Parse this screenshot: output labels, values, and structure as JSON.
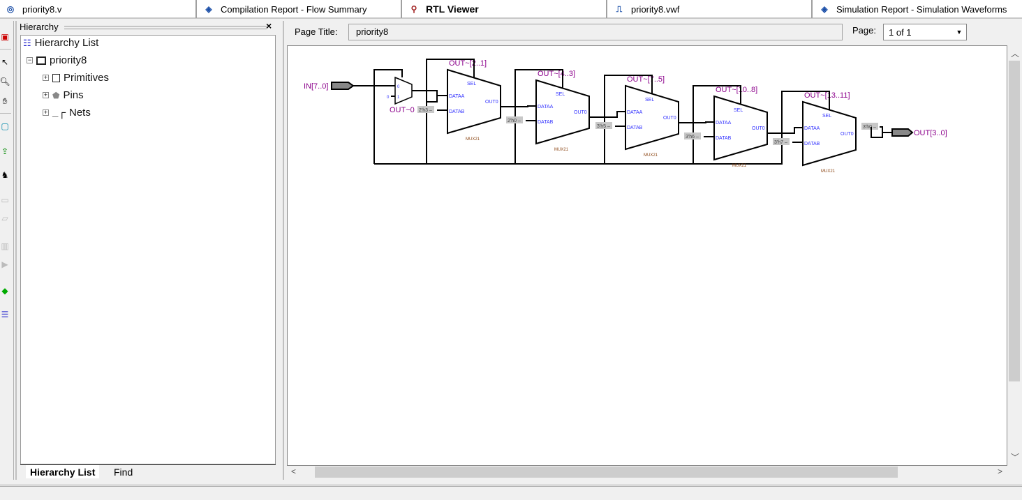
{
  "tabs": [
    {
      "label": "priority8.v",
      "icon": "verilog-file-icon"
    },
    {
      "label": "Compilation Report - Flow Summary",
      "icon": "report-icon"
    },
    {
      "label": "RTL Viewer",
      "icon": "rtl-viewer-icon",
      "active": true
    },
    {
      "label": "priority8.vwf",
      "icon": "waveform-file-icon"
    },
    {
      "label": "Simulation Report - Simulation Waveforms",
      "icon": "report-icon"
    }
  ],
  "hierarchy": {
    "title": "Hierarchy",
    "root_label": "Hierarchy List",
    "top": "priority8",
    "children": [
      {
        "label": "Primitives"
      },
      {
        "label": "Pins"
      },
      {
        "label": "Nets"
      }
    ],
    "bottom_tabs": [
      "Hierarchy List",
      "Find"
    ]
  },
  "viewer": {
    "page_title_label": "Page Title:",
    "page_title": "priority8",
    "page_label": "Page:",
    "page_value": "1 of 1"
  },
  "schematic": {
    "input_pin": "IN[7..0]",
    "output_pin": "OUT[3..0]",
    "first_mux": {
      "label": "OUT~0",
      "in0": "0",
      "in1": "1",
      "const": "0"
    },
    "mux_port_labels": {
      "sel": "SEL",
      "a": "DATAA",
      "b": "DATAB",
      "out": "OUT0",
      "type": "MUX21"
    },
    "muxes": [
      {
        "label": "OUT~[2..1]",
        "const": "2'h3"
      },
      {
        "label": "OUT~[4..3]",
        "const": "2'h0"
      },
      {
        "label": "OUT~[7..5]",
        "const": "3'h5"
      },
      {
        "label": "OUT~[10..8]",
        "const": "3'h6"
      },
      {
        "label": "OUT~[13..11]",
        "const": "3'h7"
      }
    ],
    "output_const": "3'h0",
    "colors": {
      "label": "#8b008b",
      "port": "#3030ff",
      "type": "#8b4513",
      "const_bg": "#c8c8c8"
    }
  }
}
